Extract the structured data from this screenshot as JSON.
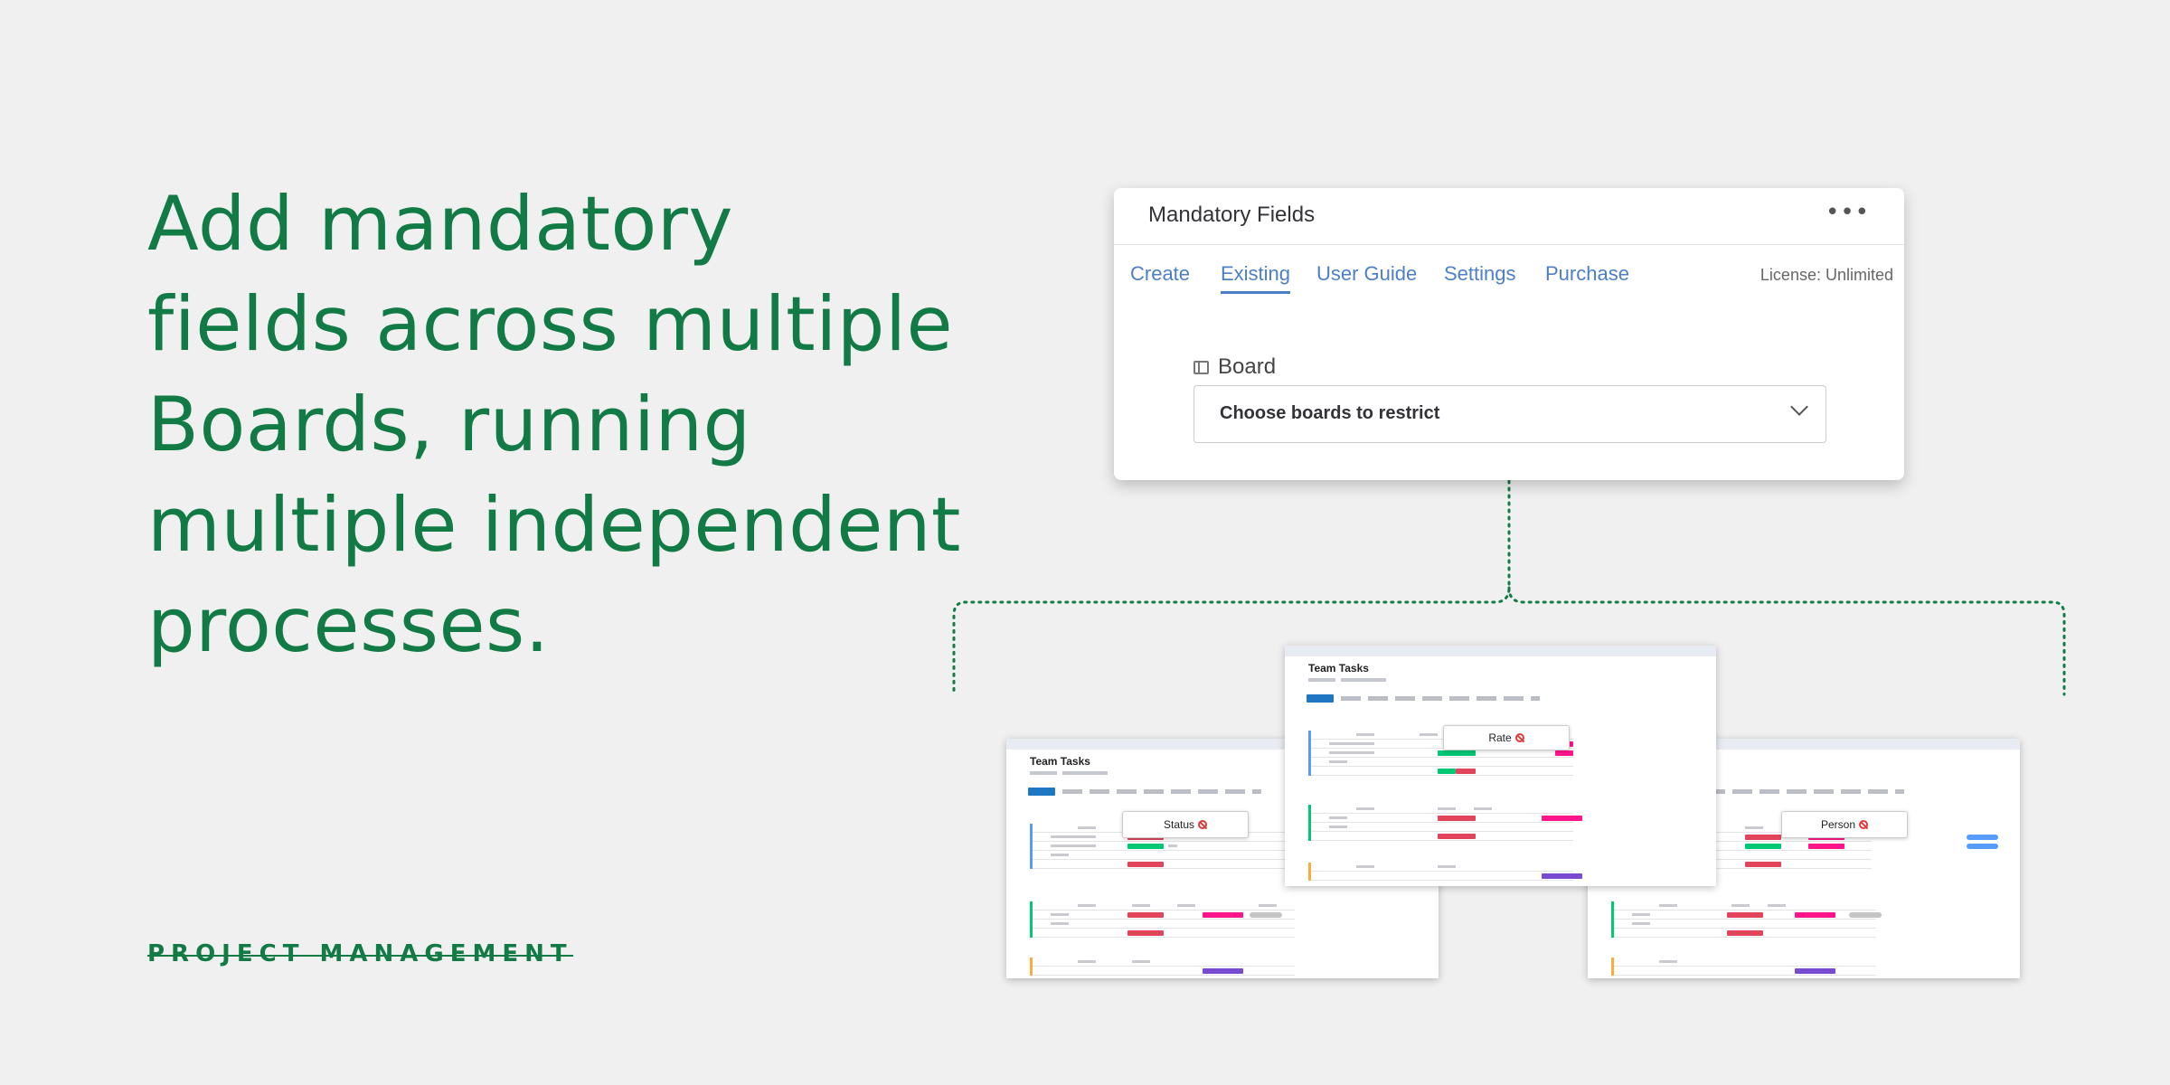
{
  "headline": {
    "lines": [
      "Add mandatory",
      "fields across multiple",
      "Boards, running",
      "multiple independent",
      "processes."
    ]
  },
  "category": "PROJECT MANAGEMENT",
  "app_card": {
    "title": "Mandatory Fields",
    "more_icon": "ellipsis-icon",
    "tabs": [
      "Create",
      "Existing",
      "User Guide",
      "Settings",
      "Purchase"
    ],
    "active_tab": "Existing",
    "license": "License: Unlimited",
    "board_label": "Board",
    "board_icon": "board-icon",
    "select_placeholder": "Choose boards to restrict",
    "select_icon": "chevron-down-icon"
  },
  "boards": {
    "center": {
      "title": "Team Tasks",
      "tag": "Rate"
    },
    "left": {
      "title": "Team Tasks",
      "tag": "Status"
    },
    "right": {
      "title": "",
      "tag": "Person"
    }
  },
  "colors": {
    "brand_green": "#127a45",
    "link_blue": "#4d7fc7",
    "status_red": "#e2445c",
    "status_pink": "#ff158a",
    "status_green": "#00c875",
    "status_purple": "#784bd1"
  }
}
